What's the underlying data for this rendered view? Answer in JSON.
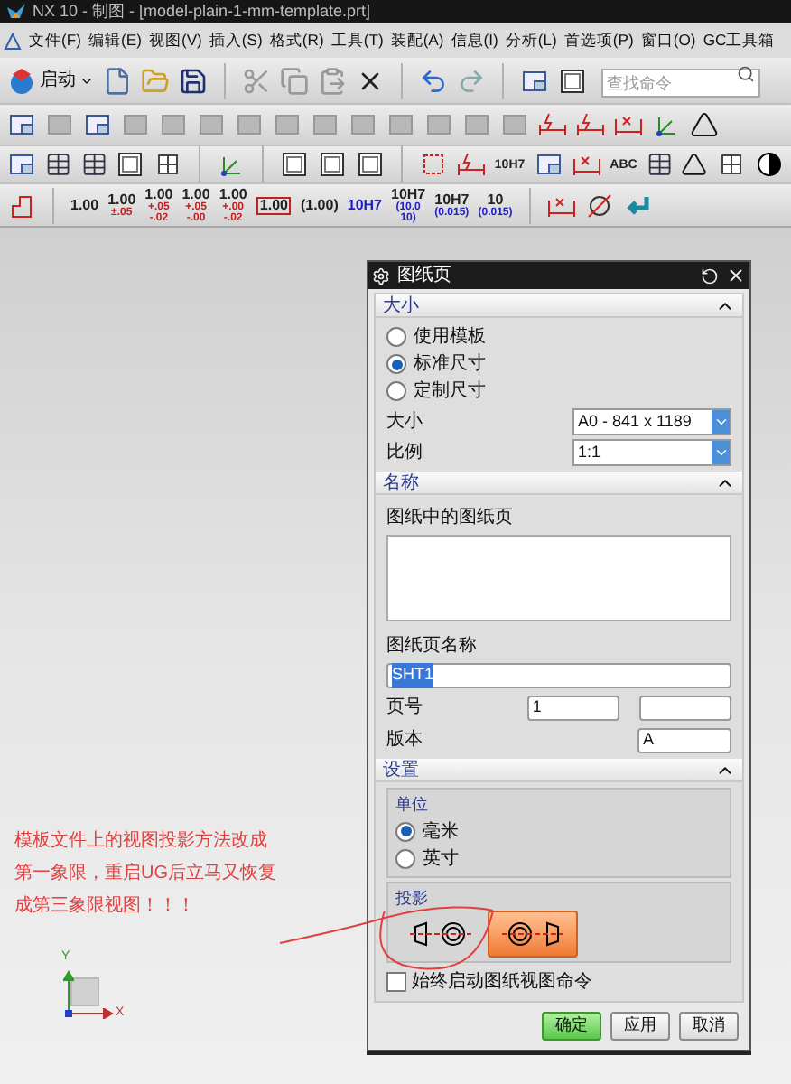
{
  "window": {
    "title": "NX 10 - 制图 - [model-plain-1-mm-template.prt]"
  },
  "menu": [
    "文件(F)",
    "编辑(E)",
    "视图(V)",
    "插入(S)",
    "格式(R)",
    "工具(T)",
    "装配(A)",
    "信息(I)",
    "分析(L)",
    "首选项(P)",
    "窗口(O)",
    "GC工具箱"
  ],
  "toolbar_1": {
    "start_button": "启动",
    "search": {
      "placeholder": "查找命令"
    }
  },
  "toolbar_3": {
    "labels": [
      "10H7",
      "ABC"
    ]
  },
  "dimension_styles": [
    {
      "kind": "plain",
      "value": "1.00",
      "color": "#202020"
    },
    {
      "kind": "plain",
      "value": "1.00",
      "tolerance": [
        "±.05"
      ],
      "color": "#c02020"
    },
    {
      "kind": "plain",
      "value": "1.00",
      "tolerance": [
        "+.05",
        "-.02"
      ],
      "color": "#c02020"
    },
    {
      "kind": "plain",
      "value": "1.00",
      "tolerance": [
        "+.05",
        "-.00"
      ],
      "color": "#c02020"
    },
    {
      "kind": "plain",
      "value": "1.00",
      "tolerance": [
        "+.00",
        "-.02"
      ],
      "color": "#c02020"
    },
    {
      "kind": "boxed",
      "value": "1.00",
      "color": "#202020"
    },
    {
      "kind": "plain",
      "value": "(1.00)",
      "color": "#202020"
    },
    {
      "kind": "plain",
      "value": "10H7",
      "color": "#2020c0"
    },
    {
      "kind": "plain",
      "value": "10H7",
      "tolerance": [
        "(10.0",
        "10)"
      ],
      "color": "#2020c0"
    },
    {
      "kind": "plain",
      "value": "10H7",
      "tolerance": [
        "(0.015)"
      ],
      "color": "#2020c0"
    },
    {
      "kind": "plain",
      "value": "10",
      "tolerance": [
        "(0.015)"
      ],
      "color": "#2020c0"
    }
  ],
  "dialog": {
    "title": "图纸页",
    "size_section": {
      "title": "大小",
      "expanded": true,
      "options": [
        {
          "label": "使用模板",
          "selected": false
        },
        {
          "label": "标准尺寸",
          "selected": true
        },
        {
          "label": "定制尺寸",
          "selected": false
        }
      ],
      "size": {
        "label": "大小",
        "value": "A0 - 841 x 1189"
      },
      "scale": {
        "label": "比例",
        "value": "1:1"
      }
    },
    "name_section": {
      "title": "名称",
      "expanded": true,
      "list_label": "图纸中的图纸页",
      "sheet_name": {
        "label": "图纸页名称",
        "value": "SHT1"
      },
      "page_number": {
        "label": "页号",
        "value": "1"
      },
      "revision": {
        "label": "版本",
        "value": "A"
      }
    },
    "settings_section": {
      "title": "设置",
      "expanded": true,
      "units": {
        "title": "单位",
        "options": [
          {
            "label": "毫米",
            "selected": true
          },
          {
            "label": "英寸",
            "selected": false
          }
        ]
      },
      "projection": {
        "title": "投影",
        "options": [
          {
            "kind": "first-angle",
            "selected": false
          },
          {
            "kind": "third-angle",
            "selected": true
          }
        ]
      },
      "always_start": {
        "label": "始终启动图纸视图命令",
        "checked": false
      }
    },
    "buttons": [
      {
        "label": "确定",
        "default": true
      },
      {
        "label": "应用",
        "default": false
      },
      {
        "label": "取消",
        "default": false
      }
    ]
  },
  "annotation": {
    "lines": [
      "模板文件上的视图投影方法改成",
      "第一象限，重启UG后立马又恢复",
      "成第三象限视图！！！"
    ]
  },
  "triad": {
    "x": "X",
    "y": "Y"
  }
}
